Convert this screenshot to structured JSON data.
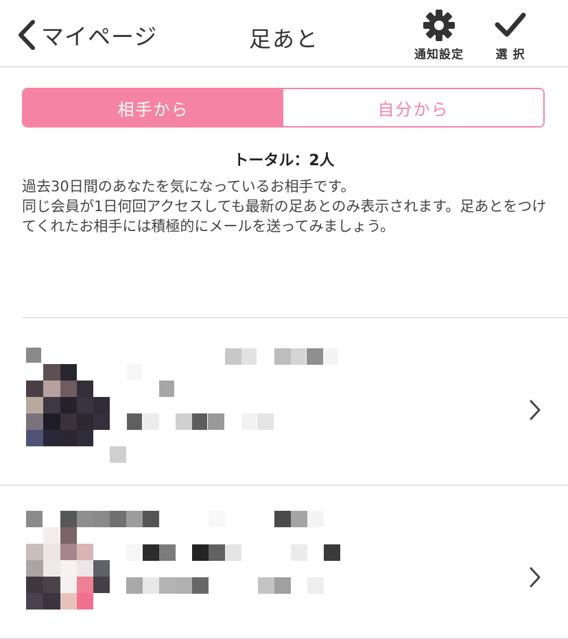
{
  "header": {
    "back_label": "マイページ",
    "title": "足あと",
    "settings_label": "通知設定",
    "select_label": "選 択"
  },
  "tabs": [
    {
      "label": "相手から",
      "active": true
    },
    {
      "label": "自分から",
      "active": false
    }
  ],
  "total": "トータル：2人",
  "description": [
    "過去30日間のあなたを気になっているお相手です。",
    "同じ会員が1日何回アクセスしても最新の足あとのみ表示されます。足あとをつけてくれたお相手には積極的にメールを送ってみましょう。"
  ],
  "colors": {
    "accent": "#f584a4",
    "divider": "#d0d0d0",
    "text": "#333333"
  },
  "list_items": [
    {
      "redacted": true
    },
    {
      "redacted": true
    }
  ]
}
